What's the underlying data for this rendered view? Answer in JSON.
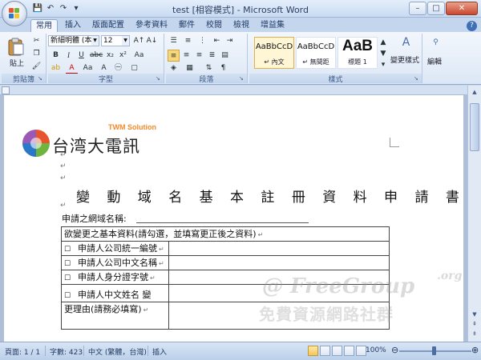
{
  "window": {
    "title": "test [相容模式] - Microsoft Word",
    "minimize": "–",
    "maximize": "□",
    "close": "✕"
  },
  "quick_access": [
    "save-icon",
    "undo-icon",
    "redo-icon"
  ],
  "tabs": [
    "常用",
    "插入",
    "版面配置",
    "參考資料",
    "郵件",
    "校閱",
    "檢視",
    "增益集"
  ],
  "active_tab": "常用",
  "help": "?",
  "ribbon": {
    "clipboard": {
      "label": "剪貼簿",
      "paste": "貼上"
    },
    "font": {
      "label": "字型",
      "font_name": "新細明體 (本文",
      "font_size": "12",
      "bold": "B",
      "italic": "I",
      "underline": "U",
      "strike": "abc",
      "subscript": "x₂",
      "superscript": "x²",
      "clear": "Aa",
      "phonetic": "A"
    },
    "paragraph": {
      "label": "段落"
    },
    "styles": {
      "label": "樣式",
      "items": [
        {
          "sample": "AaBbCcD",
          "name": "↵ 內文"
        },
        {
          "sample": "AaBbCcD",
          "name": "↵ 無間距"
        },
        {
          "sample": "AaB",
          "name": "標題 1"
        }
      ],
      "change_styles": "變更樣式"
    },
    "editing": {
      "label": "編輯"
    }
  },
  "document": {
    "logo_text": "台湾大電訊",
    "logo_sub": "TWM Solution",
    "title": "變 動 域 名 基 本 註 冊 資 料 申 請 書",
    "domain_label": "申請之網域名稱:",
    "table": {
      "header": "欲變更之基本資料(請勾選，並填寫更正後之資料)",
      "rows": [
        "申請人公司統一編號",
        "申請人公司中文名稱",
        "申請人身分證字號",
        "申請人中文姓名 變"
      ],
      "reason": "更理由(請務必填寫)"
    },
    "para_mark": "↵"
  },
  "watermark": {
    "line1": "@ FreeGroup",
    "org": ".org",
    "line2": "免費資源網路社群"
  },
  "status": {
    "page": "頁面: 1 / 1",
    "words": "字數: 423",
    "language": "中文 (繁體，台灣)",
    "mode": "插入",
    "zoom": "100%"
  },
  "colors": {
    "accent": "#3f6fb5",
    "logo_orange": "#f38a2a"
  }
}
